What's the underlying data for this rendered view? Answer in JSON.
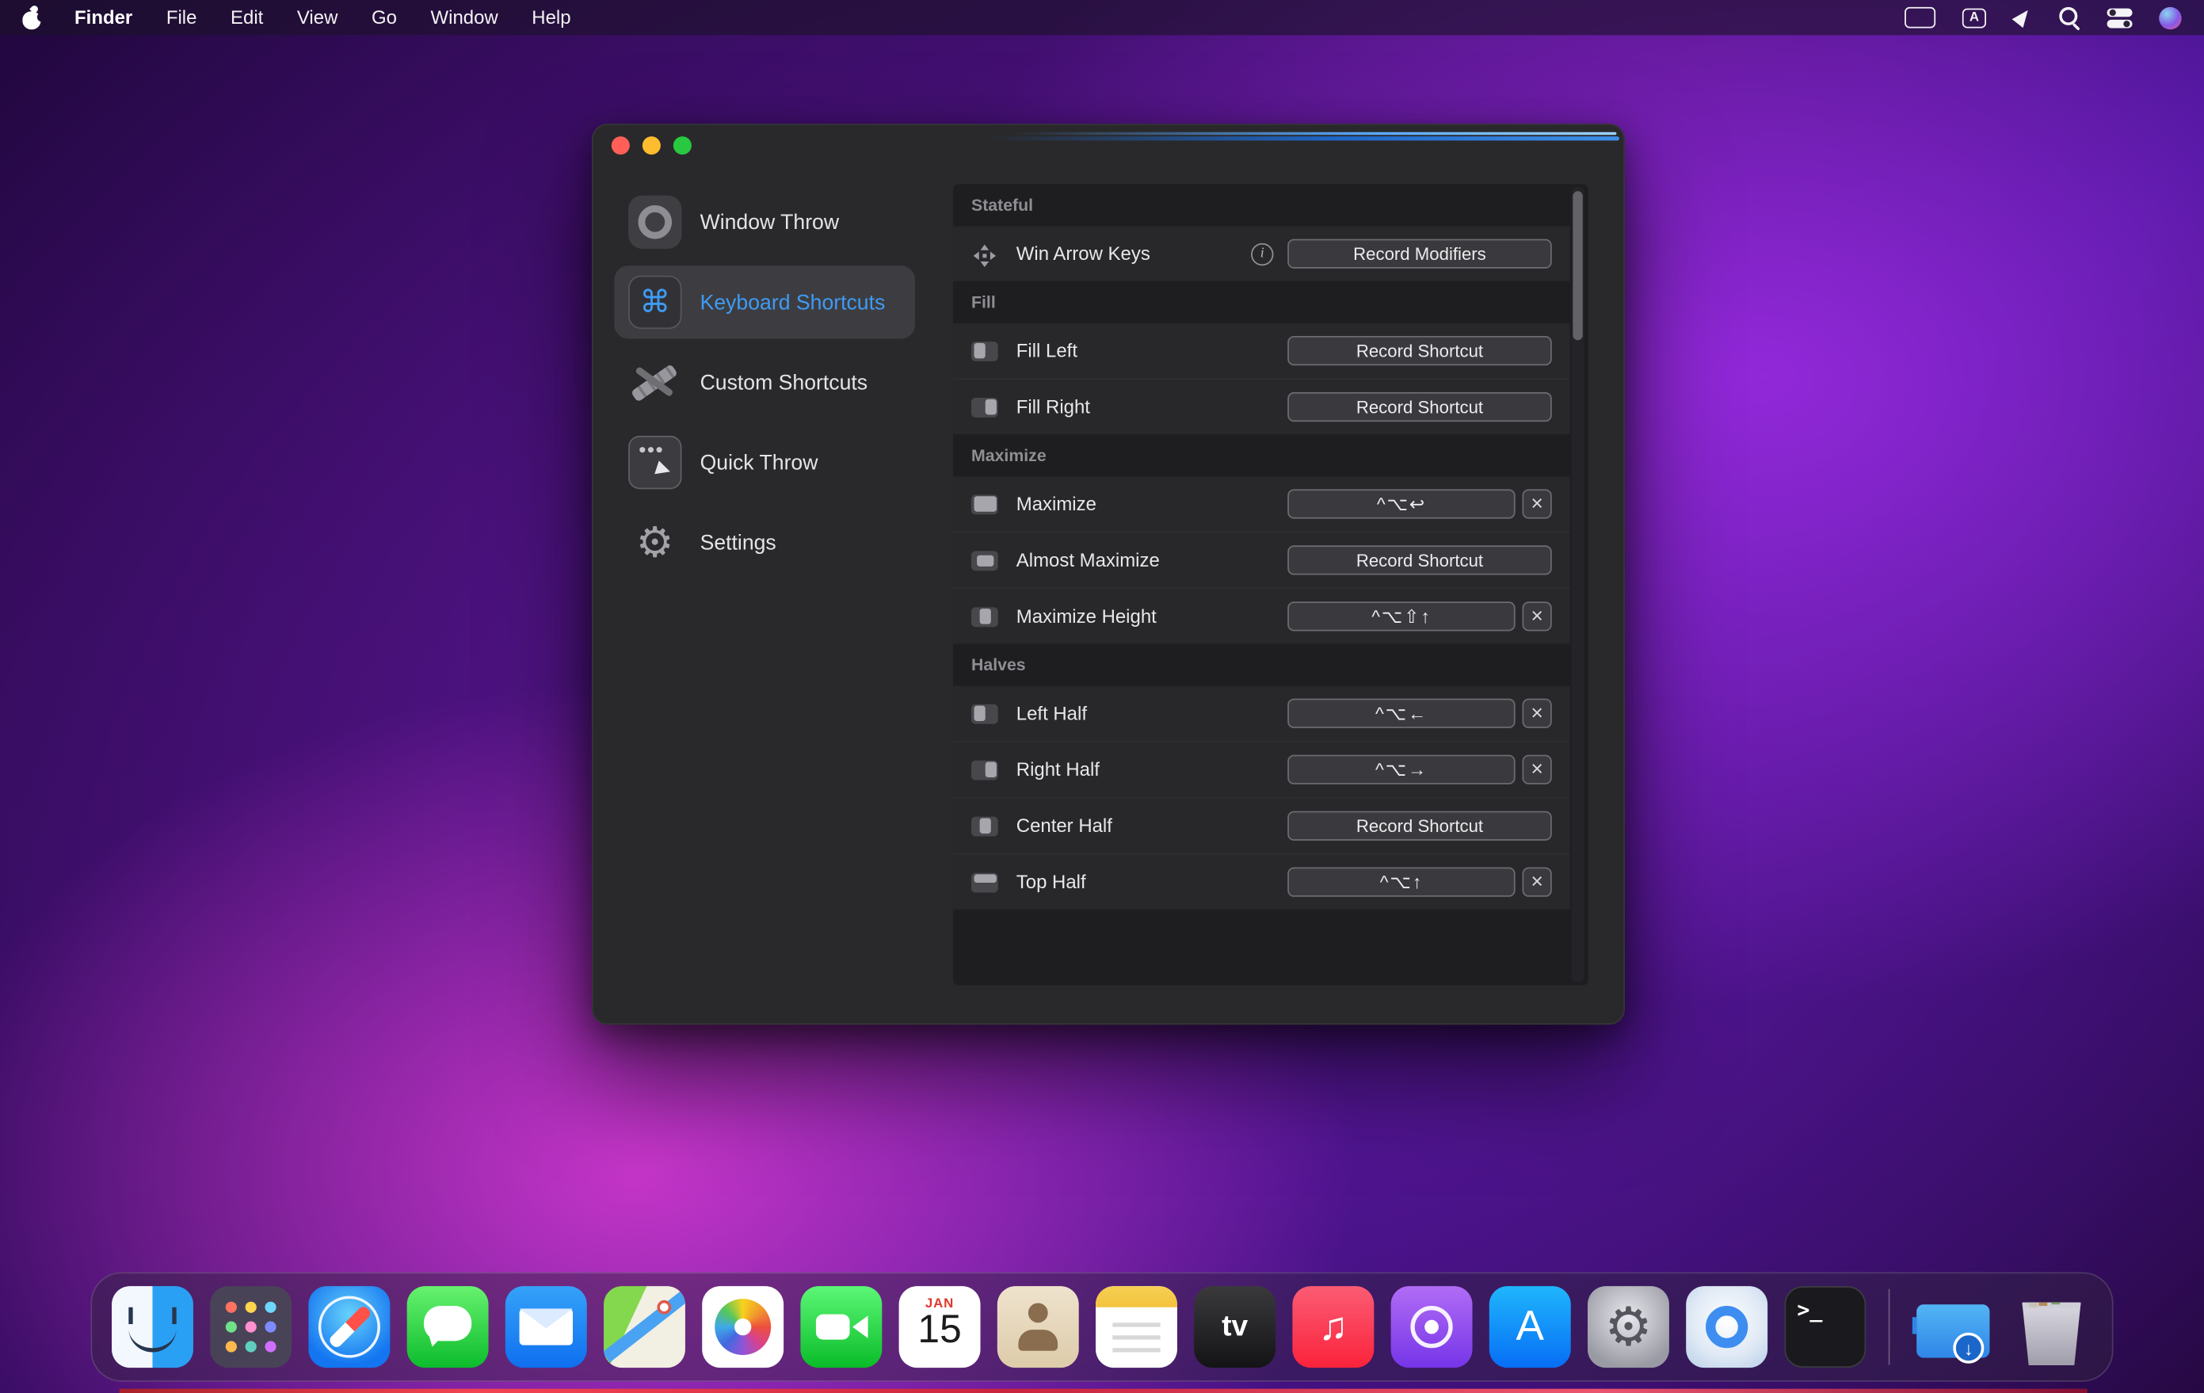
{
  "colors": {
    "accent_blue": "#3E9BF5",
    "window_bg": "#29292B",
    "wallpaper_magenta": "#D841D8"
  },
  "menu_bar": {
    "app_name": "Finder",
    "menus": [
      "File",
      "Edit",
      "View",
      "Go",
      "Window",
      "Help"
    ],
    "status_icons": [
      "input-source-icon",
      "character-viewer-icon",
      "location-icon",
      "search-icon",
      "control-center-icon",
      "siri-icon"
    ]
  },
  "window": {
    "sidebar": {
      "items": [
        {
          "label": "Window Throw",
          "icon": "window-throw-icon",
          "selected": false
        },
        {
          "label": "Keyboard Shortcuts",
          "icon": "command-icon",
          "selected": true
        },
        {
          "label": "Custom Shortcuts",
          "icon": "custom-shortcuts-icon",
          "selected": false
        },
        {
          "label": "Quick Throw",
          "icon": "quick-throw-icon",
          "selected": false
        },
        {
          "label": "Settings",
          "icon": "gear-icon",
          "selected": false
        }
      ]
    },
    "sections": [
      {
        "title": "Stateful",
        "rows": [
          {
            "label": "Win Arrow Keys",
            "icon": "arrow-keys-icon",
            "info": true,
            "control": {
              "type": "button",
              "label": "Record Modifiers"
            }
          }
        ]
      },
      {
        "title": "Fill",
        "rows": [
          {
            "label": "Fill Left",
            "icon": "fill-left-icon",
            "control": {
              "type": "button",
              "label": "Record Shortcut"
            }
          },
          {
            "label": "Fill Right",
            "icon": "fill-right-icon",
            "control": {
              "type": "button",
              "label": "Record Shortcut"
            }
          }
        ]
      },
      {
        "title": "Maximize",
        "rows": [
          {
            "label": "Maximize",
            "icon": "maximize-icon",
            "control": {
              "type": "shortcut",
              "value": "^⌥↩"
            }
          },
          {
            "label": "Almost Maximize",
            "icon": "almost-maximize-icon",
            "control": {
              "type": "button",
              "label": "Record Shortcut"
            }
          },
          {
            "label": "Maximize Height",
            "icon": "maximize-height-icon",
            "control": {
              "type": "shortcut",
              "value": "^⌥⇧↑"
            }
          }
        ]
      },
      {
        "title": "Halves",
        "rows": [
          {
            "label": "Left Half",
            "icon": "left-half-icon",
            "control": {
              "type": "shortcut",
              "value": "^⌥←"
            }
          },
          {
            "label": "Right Half",
            "icon": "right-half-icon",
            "control": {
              "type": "shortcut",
              "value": "^⌥→"
            }
          },
          {
            "label": "Center Half",
            "icon": "center-half-icon",
            "control": {
              "type": "button",
              "label": "Record Shortcut"
            }
          },
          {
            "label": "Top Half",
            "icon": "top-half-icon",
            "control": {
              "type": "shortcut",
              "value": "^⌥↑"
            }
          }
        ]
      }
    ]
  },
  "dock": {
    "items": [
      {
        "name": "finder"
      },
      {
        "name": "launchpad"
      },
      {
        "name": "safari"
      },
      {
        "name": "messages"
      },
      {
        "name": "mail"
      },
      {
        "name": "maps"
      },
      {
        "name": "photos"
      },
      {
        "name": "facetime"
      },
      {
        "name": "calendar",
        "month": "JAN",
        "day": "15"
      },
      {
        "name": "contacts"
      },
      {
        "name": "notes"
      },
      {
        "name": "appletv",
        "glyph": "tv"
      },
      {
        "name": "music",
        "glyph": "♫"
      },
      {
        "name": "podcasts"
      },
      {
        "name": "appstore",
        "glyph": "A"
      },
      {
        "name": "system-preferences"
      },
      {
        "name": "window-throw-app"
      },
      {
        "name": "terminal",
        "glyph": ">_"
      },
      {
        "name": "separator"
      },
      {
        "name": "downloads"
      },
      {
        "name": "trash"
      }
    ]
  }
}
